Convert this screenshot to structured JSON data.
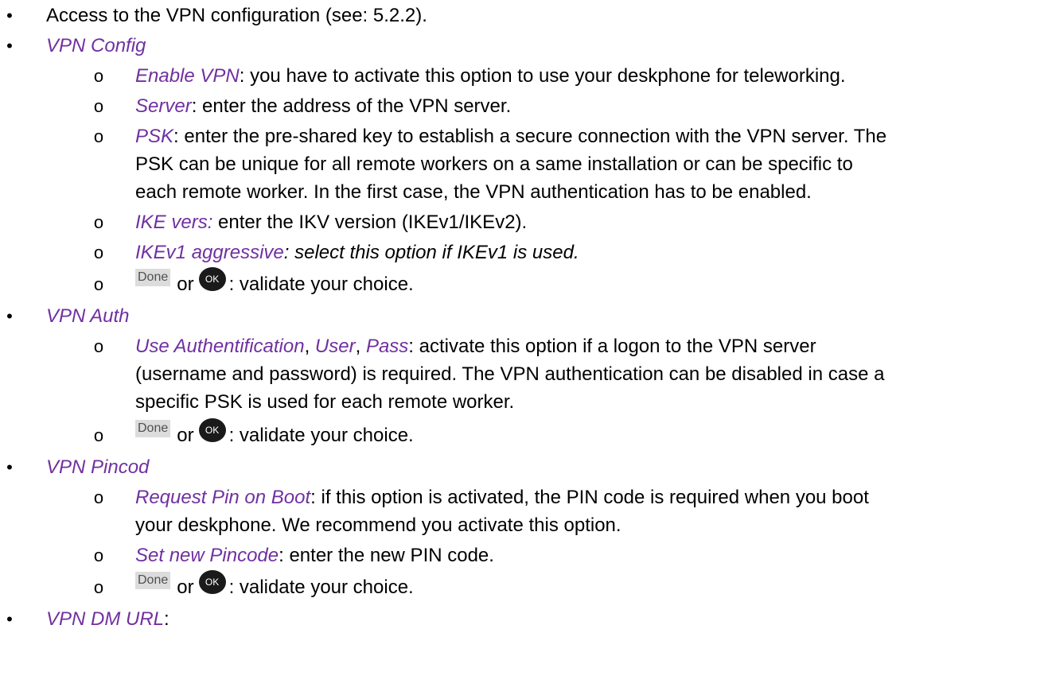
{
  "bullet_glyph": "•",
  "sub_bullet_glyph": "o",
  "intro": "Access to the VPN configuration (see: 5.2.2).",
  "vpn_config": {
    "title": "VPN Config",
    "enable_vpn": {
      "term": "Enable VPN",
      "desc": ": you have to activate this option to use your deskphone for teleworking."
    },
    "server": {
      "term": "Server",
      "desc": ": enter the address of the VPN server."
    },
    "psk": {
      "term": "PSK",
      "line1": ": enter the pre-shared key to establish a secure connection with the VPN server. The",
      "line2": "PSK can be unique for all remote workers on a same installation or can be specific to",
      "line3": "each remote worker. In the first case, the VPN authentication has to be enabled."
    },
    "ike_vers": {
      "term": "IKE vers:",
      "desc": " enter the IKV version (IKEv1/IKEv2)."
    },
    "ikev1_aggressive": {
      "term": "IKEv1 aggressive",
      "desc": ": select this option if IKEv1 is used."
    }
  },
  "vpn_auth": {
    "title": "VPN Auth",
    "term1": "Use Authentification",
    "sep1": ", ",
    "term2": "User",
    "sep2": ", ",
    "term3": "Pass",
    "line1": ": activate this option if a logon to the VPN server",
    "line2": "(username and password) is required. The VPN authentication can be disabled in case a",
    "line3": "specific PSK is used for each remote worker."
  },
  "vpn_pincod": {
    "title": "VPN Pincod",
    "request_pin": {
      "term": "Request Pin on Boot",
      "line1": ": if this option is activated, the PIN code is required when you boot",
      "line2": "your deskphone. We recommend you activate this option."
    },
    "set_pin": {
      "term": "Set new Pincode",
      "desc": ": enter the new PIN code."
    }
  },
  "vpn_dm_url": {
    "title": "VPN DM URL",
    "suffix": ":"
  },
  "validate": {
    "done_label": "Done",
    "or_text": "or",
    "ok_label": "OK",
    "desc": ": validate your choice."
  }
}
